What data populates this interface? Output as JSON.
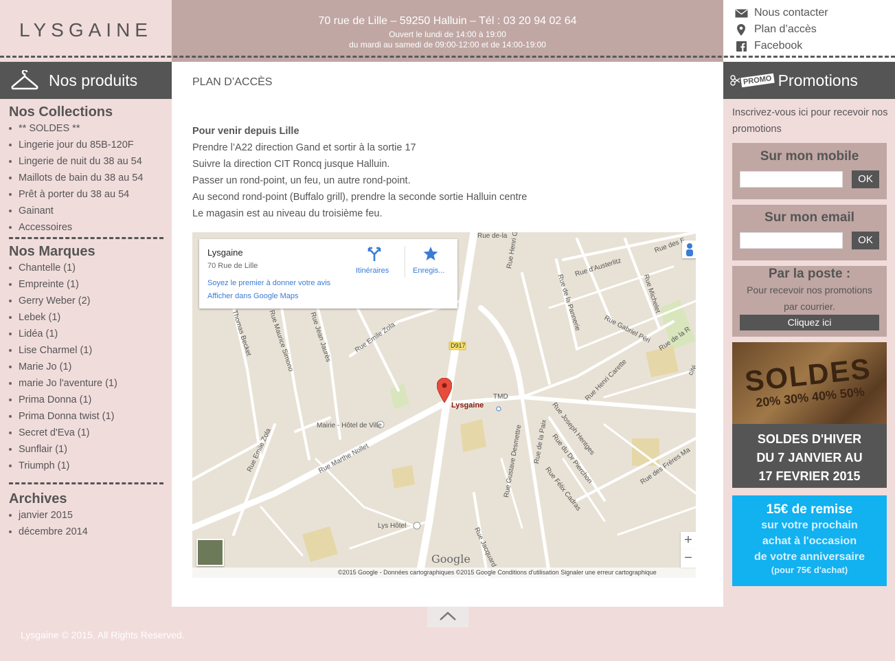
{
  "header": {
    "logo": "LYSGAINE",
    "address": "70 rue de Lille – 59250 Halluin – Tél : 03 20 94 02 64",
    "hours_1": "Ouvert le lundi de 14:00 à 19:00",
    "hours_2": "du mardi au samedi de 09:00-12:00 et de 14:00-19:00",
    "links": [
      {
        "label": "Nous contacter",
        "icon": "envelope-icon"
      },
      {
        "label": "Plan d’accès",
        "icon": "map-pin-icon"
      },
      {
        "label": "Facebook",
        "icon": "facebook-icon"
      }
    ]
  },
  "left": {
    "title": "Nos produits",
    "collections_title": "Nos Collections",
    "collections": [
      "** SOLDES **",
      "Lingerie jour du 85B-120F",
      "Lingerie de nuit du 38 au 54",
      "Maillots de bain du 38 au 54",
      "Prêt à porter du 38 au 54",
      "Gainant",
      "Accessoires"
    ],
    "brands_title": "Nos Marques",
    "brands": [
      "Chantelle (1)",
      "Empreinte (1)",
      "Gerry Weber (2)",
      "Lebek (1)",
      "Lidéa (1)",
      "Lise Charmel (1)",
      "Marie Jo (1)",
      "marie Jo l'aventure (1)",
      "Prima Donna (1)",
      "Prima Donna twist (1)",
      "Secret d'Eva (1)",
      "Sunflair (1)",
      "Triumph (1)"
    ],
    "archives_title": "Archives",
    "archives": [
      "janvier 2015",
      "décembre 2014"
    ]
  },
  "main": {
    "title": "PLAN D’ACCÈS",
    "dir_heading": "Pour venir depuis Lille",
    "dir_lines": [
      "Prendre l’A22 direction Gand et sortir à la sortie 17",
      "Suivre la direction CIT Roncq jusque Halluin.",
      "Passer un rond-point, un feu, un autre rond-point.",
      "Au second rond-point (Buffalo grill), prendre la seconde sortie Halluin centre",
      "Le magasin est au niveau du troisième feu."
    ],
    "map": {
      "name": "Lysgaine",
      "address": "70 Rue de Lille",
      "review_link": "Soyez le premier à donner votre avis",
      "gmaps_link": "Afficher dans Google Maps",
      "directions": "Itinéraires",
      "save": "Enregis...",
      "marker": "Lysgaine",
      "google": "Google",
      "attribution": "©2015 Google - Données cartographiques ©2015 Google     Conditions d'utilisation     Signaler une erreur cartographique",
      "zoom_in": "+",
      "zoom_out": "−",
      "labels": [
        "Rue de-la",
        "Rue des F",
        "Rue d'Austerlitz",
        "Rue Henri Ghesquière",
        "Rue de la Pannerie",
        "Rue Michelet",
        "Rue Gabriel Péri",
        "Rue de la R",
        "Rue Emile Zola",
        "Thomas Becket",
        "Rue Maurice Simono",
        "Rue Jean Jaurès",
        "D917",
        "TMD",
        "Mairie - Hôtel de Ville",
        "Rue Henri Carette",
        "Rue Joseph Hentges",
        "Rue du Dr Pierchon",
        "Rue Gustave Desmettre",
        "Rue de la Paix",
        "Rue Félix Cadras",
        "Rue des Frères Ma",
        "Rue Emile Zola",
        "Rue Marthe Nollet",
        "Lys Hôtel",
        "Rue Jacquard",
        "cité"
      ]
    }
  },
  "right": {
    "title": "Promotions",
    "promo_badge": "PROMO",
    "intro": "Inscrivez-vous ici pour recevoir nos promotions",
    "mobile_title": "Sur mon mobile",
    "email_title": "Sur mon email",
    "ok": "OK",
    "post_title": "Par la poste :",
    "post_text": "Pour recevoir nos promotions par courrier.",
    "post_button": "Cliquez ici",
    "soldes_img": "SOLDES",
    "soldes_pct": "20% 30% 40% 50%",
    "soldes_lines": [
      "SOLDES D'HIVER",
      "DU 7 JANVIER AU",
      "17 FEVRIER 2015"
    ],
    "promo15_title": "15€ de remise",
    "promo15_lines": [
      "sur votre prochain",
      "achat à l'occasion",
      "de votre anniversaire"
    ],
    "promo15_note": "(pour 75€ d'achat)"
  },
  "footer": "Lysgaine © 2015. All Rights Reserved."
}
